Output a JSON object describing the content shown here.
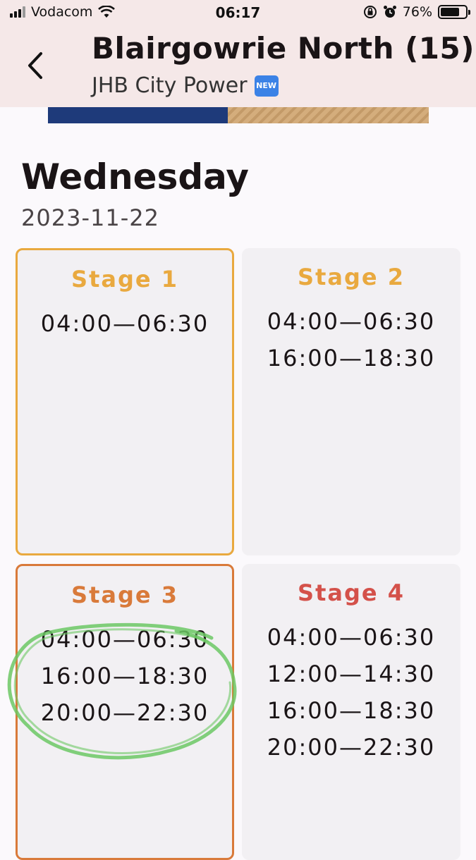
{
  "status_bar": {
    "carrier": "Vodacom",
    "time": "06:17",
    "battery_percent": "76%",
    "battery_level": 0.76
  },
  "header": {
    "title": "Blairgowrie North (15)",
    "subtitle": "JHB City Power",
    "badge": "NEW"
  },
  "schedule": {
    "day": "Wednesday",
    "date": "2023-11-22",
    "stages": [
      {
        "label": "Stage 1",
        "color": "#e9a93f",
        "slots": [
          "04:00—06:30"
        ]
      },
      {
        "label": "Stage 2",
        "color": "#e9a93f",
        "slots": [
          "04:00—06:30",
          "16:00—18:30"
        ]
      },
      {
        "label": "Stage 3",
        "color": "#d97a3a",
        "slots": [
          "04:00—06:30",
          "16:00—18:30",
          "20:00—22:30"
        ]
      },
      {
        "label": "Stage 4",
        "color": "#d4514a",
        "slots": [
          "04:00—06:30",
          "12:00—14:30",
          "16:00—18:30",
          "20:00—22:30"
        ]
      }
    ]
  },
  "colors": {
    "header_bg": "#f5e8e8",
    "annotation": "#6cc864"
  }
}
